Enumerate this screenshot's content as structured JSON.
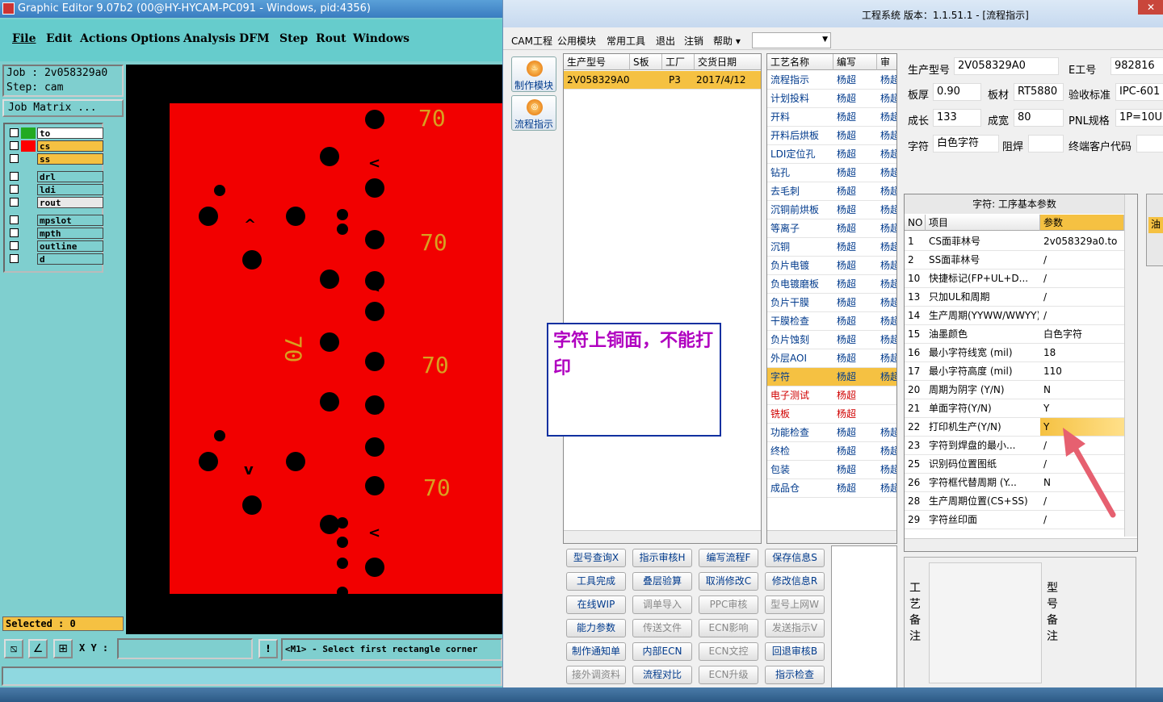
{
  "graphic_editor": {
    "title": "Graphic Editor 9.07b2 (00@HY-HYCAM-PC091 - Windows, pid:4356)",
    "menu": [
      "File",
      "Edit",
      "Actions",
      "Options",
      "Analysis",
      "DFM",
      "Step",
      "Rout",
      "Windows"
    ],
    "job": "Job : 2v058329a0",
    "step": "Step: cam",
    "job_matrix": "Job Matrix ...",
    "layers": [
      {
        "name": "to",
        "swatch": "#22aa22",
        "bg": "#ffffff"
      },
      {
        "name": "cs",
        "swatch": "#ff0000",
        "bg": "#f5c142"
      },
      {
        "name": "ss",
        "swatch": "#7fcfcf",
        "bg": "#f5c142"
      },
      {
        "name": "drl",
        "swatch": "#7fcfcf",
        "bg": "#7fcfcf"
      },
      {
        "name": "ldi",
        "swatch": "#7fcfcf",
        "bg": "#7fcfcf"
      },
      {
        "name": "rout",
        "swatch": "#7fcfcf",
        "bg": "#e8e8e8"
      },
      {
        "name": "mpslot",
        "swatch": "#7fcfcf",
        "bg": "#7fcfcf"
      },
      {
        "name": "mpth",
        "swatch": "#7fcfcf",
        "bg": "#7fcfcf"
      },
      {
        "name": "outline",
        "swatch": "#7fcfcf",
        "bg": "#7fcfcf"
      },
      {
        "name": "d",
        "swatch": "#7fcfcf",
        "bg": "#7fcfcf"
      }
    ],
    "board_labels": [
      "70",
      "70",
      "70",
      "70",
      "70"
    ],
    "selected": "Selected : 0",
    "xy_label": "X Y :",
    "xy_value": "",
    "prompt": "<M1> - Select first rectangle corner"
  },
  "system": {
    "title": "工程系统   版本：1.1.51.1 - [流程指示]",
    "close": "✕",
    "menu": [
      "CAM工程",
      "公用模块",
      "常用工具",
      "退出",
      "注销",
      "帮助 ▾"
    ],
    "side_buttons": [
      "制作模块",
      "流程指示"
    ],
    "order_grid": {
      "headers": [
        "生产型号",
        "S板",
        "工厂",
        "交货日期"
      ],
      "rows": [
        [
          "2V058329A0",
          "",
          "P3",
          "2017/4/12"
        ]
      ]
    },
    "process_grid": {
      "headers": [
        "工艺名称",
        "编写",
        "审"
      ],
      "rows": [
        {
          "name": "流程指示",
          "author": "杨超",
          "rev": "杨超",
          "red": false,
          "hl": false
        },
        {
          "name": "计划投料",
          "author": "杨超",
          "rev": "杨超",
          "red": false,
          "hl": false
        },
        {
          "name": "开料",
          "author": "杨超",
          "rev": "杨超",
          "red": false,
          "hl": false
        },
        {
          "name": "开料后烘板",
          "author": "杨超",
          "rev": "杨超",
          "red": false,
          "hl": false
        },
        {
          "name": "LDI定位孔",
          "author": "杨超",
          "rev": "杨超",
          "red": false,
          "hl": false
        },
        {
          "name": "钻孔",
          "author": "杨超",
          "rev": "杨超",
          "red": false,
          "hl": false
        },
        {
          "name": "去毛刺",
          "author": "杨超",
          "rev": "杨超",
          "red": false,
          "hl": false
        },
        {
          "name": "沉铜前烘板",
          "author": "杨超",
          "rev": "杨超",
          "red": false,
          "hl": false
        },
        {
          "name": "等离子",
          "author": "杨超",
          "rev": "杨超",
          "red": false,
          "hl": false
        },
        {
          "name": "沉铜",
          "author": "杨超",
          "rev": "杨超",
          "red": false,
          "hl": false
        },
        {
          "name": "负片电镀",
          "author": "杨超",
          "rev": "杨超",
          "red": false,
          "hl": false
        },
        {
          "name": "负电镀磨板",
          "author": "杨超",
          "rev": "杨超",
          "red": false,
          "hl": false
        },
        {
          "name": "负片干膜",
          "author": "杨超",
          "rev": "杨超",
          "red": false,
          "hl": false
        },
        {
          "name": "干膜检查",
          "author": "杨超",
          "rev": "杨超",
          "red": false,
          "hl": false
        },
        {
          "name": "负片蚀刻",
          "author": "杨超",
          "rev": "杨超",
          "red": false,
          "hl": false
        },
        {
          "name": "外层AOI",
          "author": "杨超",
          "rev": "杨超",
          "red": false,
          "hl": false
        },
        {
          "name": "字符",
          "author": "杨超",
          "rev": "杨超",
          "red": false,
          "hl": true
        },
        {
          "name": "电子测试",
          "author": "杨超",
          "rev": "",
          "red": true,
          "hl": false
        },
        {
          "name": "铣板",
          "author": "杨超",
          "rev": "",
          "red": true,
          "hl": false
        },
        {
          "name": "功能检查",
          "author": "杨超",
          "rev": "杨超",
          "red": false,
          "hl": false
        },
        {
          "name": "终检",
          "author": "杨超",
          "rev": "杨超",
          "red": false,
          "hl": false
        },
        {
          "name": "包装",
          "author": "杨超",
          "rev": "杨超",
          "red": false,
          "hl": false
        },
        {
          "name": "成品仓",
          "author": "杨超",
          "rev": "杨超",
          "red": false,
          "hl": false
        }
      ]
    },
    "action_buttons": [
      {
        "label": "型号查询X",
        "disabled": false
      },
      {
        "label": "指示审核H",
        "disabled": false
      },
      {
        "label": "编写流程F",
        "disabled": false
      },
      {
        "label": "保存信息S",
        "disabled": false
      },
      {
        "label": "工具完成",
        "disabled": false
      },
      {
        "label": "叠层验算",
        "disabled": false
      },
      {
        "label": "取消修改C",
        "disabled": false
      },
      {
        "label": "修改信息R",
        "disabled": false
      },
      {
        "label": "在线WIP",
        "disabled": false
      },
      {
        "label": "调单导入",
        "disabled": true
      },
      {
        "label": "PPC审核",
        "disabled": true
      },
      {
        "label": "型号上网W",
        "disabled": true
      },
      {
        "label": "能力参数",
        "disabled": false
      },
      {
        "label": "传送文件",
        "disabled": true
      },
      {
        "label": "ECN影响",
        "disabled": true
      },
      {
        "label": "发送指示V",
        "disabled": true
      },
      {
        "label": "制作通知单",
        "disabled": false
      },
      {
        "label": "内部ECN",
        "disabled": false
      },
      {
        "label": "ECN文控",
        "disabled": true
      },
      {
        "label": "回退审核B",
        "disabled": false
      },
      {
        "label": "接外调资料",
        "disabled": true
      },
      {
        "label": "流程对比",
        "disabled": false
      },
      {
        "label": "ECN升级",
        "disabled": true
      },
      {
        "label": "指示检查",
        "disabled": false
      }
    ],
    "info": {
      "model_label": "生产型号",
      "model": "2V058329A0",
      "worker_label": "E工号",
      "worker": "982816",
      "thickness_label": "板厚",
      "thickness": "0.90",
      "material_label": "板材",
      "material": "RT5880",
      "standard_label": "验收标准",
      "standard": "IPC-601",
      "length_label": "成长",
      "length": "133",
      "width_label": "成宽",
      "width": "80",
      "pnl_label": "PNL规格",
      "pnl": "1P=10U",
      "char_label": "字符",
      "char": "白色字符",
      "mask_label": "阻焊",
      "mask": "",
      "customer_label": "终端客户代码",
      "customer": ""
    },
    "param_grid": {
      "title": "字符: 工序基本参数",
      "headers": [
        "NO",
        "项目",
        "参数"
      ],
      "rows": [
        {
          "no": "1",
          "item": "CS面菲林号",
          "val": "2v058329a0.to",
          "hl": false
        },
        {
          "no": "2",
          "item": "SS面菲林号",
          "val": "/",
          "hl": false
        },
        {
          "no": "10",
          "item": "快捷标记(FP+UL+D...",
          "val": "/",
          "hl": false
        },
        {
          "no": "13",
          "item": "只加UL和周期",
          "val": "/",
          "hl": false
        },
        {
          "no": "14",
          "item": "生产周期(YYWW/WWYY)",
          "val": "/",
          "hl": false
        },
        {
          "no": "15",
          "item": "油墨颜色",
          "val": "白色字符",
          "hl": false
        },
        {
          "no": "16",
          "item": "最小字符线宽 (mil)",
          "val": "18",
          "hl": false
        },
        {
          "no": "17",
          "item": "最小字符高度 (mil)",
          "val": "110",
          "hl": false
        },
        {
          "no": "20",
          "item": "周期为阴字 (Y/N)",
          "val": "N",
          "hl": false
        },
        {
          "no": "21",
          "item": "单面字符(Y/N)",
          "val": "Y",
          "hl": false
        },
        {
          "no": "22",
          "item": "打印机生产(Y/N)",
          "val": "Y",
          "hl": true
        },
        {
          "no": "23",
          "item": "字符到焊盘的最小...",
          "val": "/",
          "hl": false
        },
        {
          "no": "25",
          "item": "识别码位置图纸",
          "val": "/",
          "hl": false
        },
        {
          "no": "26",
          "item": "字符框代替周期 (Y...",
          "val": "N",
          "hl": false
        },
        {
          "no": "28",
          "item": "生产周期位置(CS+SS)",
          "val": "/",
          "hl": false
        },
        {
          "no": "29",
          "item": "字符丝印面",
          "val": "/",
          "hl": false
        }
      ]
    },
    "remark_left": "工艺备注",
    "remark_right": "型号备注",
    "side_tab": "油"
  },
  "note": {
    "text": "字符上铜面，不能打印"
  },
  "colors": {
    "board": "#f20000",
    "label70": "#d8a020",
    "highlight": "#f5c142",
    "note_text": "#b000c0"
  }
}
